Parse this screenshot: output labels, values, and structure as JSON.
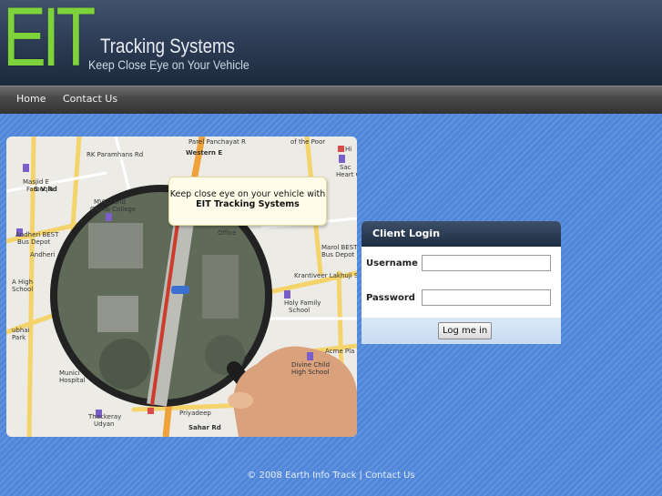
{
  "header": {
    "logo_text": "EIT",
    "brand_name": "Tracking Systems",
    "tagline": "Keep Close Eye on Your Vehicle"
  },
  "nav": {
    "items": [
      {
        "label": "Home"
      },
      {
        "label": "Contact Us"
      }
    ]
  },
  "map": {
    "callout_line1": "Keep close eye on your vehicle with",
    "callout_line2": "EIT Tracking Systems",
    "labels": [
      "Parel Panchayat R",
      "RK Paramhans Rd",
      "Masjid E",
      "Farooqia",
      "MVLU and",
      "Chinai College",
      "Andheri BEST",
      "Bus Depot",
      "Andheri",
      "A High",
      "School",
      "Marol BEST",
      "Bus Depot",
      "Krantiveer Lakhuji S",
      "Holy Family",
      "School",
      "Acme Pla",
      "Divine Child",
      "High School",
      "Priyadeep",
      "Thackeray",
      "Udyan",
      "Sahar Rd",
      "Munici",
      "Hospital",
      "of the Poor",
      "Sac",
      "Heart C",
      "Hi",
      "Office",
      "ubhai",
      "Park",
      "S V Rd",
      "Western E"
    ]
  },
  "login": {
    "title": "Client Login",
    "username_label": "Username",
    "password_label": "Password",
    "username_value": "",
    "password_value": "",
    "button_label": "Log me in"
  },
  "footer": {
    "text": "© 2008 Earth Info Track | Contact Us"
  },
  "colors": {
    "background": "#4f86d9",
    "logo_green": "#7ed33a",
    "header_dark": "#2b3a52"
  }
}
